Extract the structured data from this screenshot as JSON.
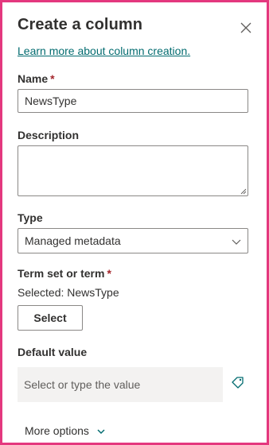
{
  "header": {
    "title": "Create a column",
    "learn_link": "Learn more about column creation."
  },
  "name_field": {
    "label": "Name",
    "required_mark": "*",
    "value": "NewsType"
  },
  "description_field": {
    "label": "Description",
    "value": ""
  },
  "type_field": {
    "label": "Type",
    "selected": "Managed metadata"
  },
  "term_set": {
    "label": "Term set or term",
    "required_mark": "*",
    "selected_text": "Selected: NewsType",
    "select_button": "Select"
  },
  "default_value": {
    "label": "Default value",
    "placeholder": "Select or type the value"
  },
  "more_options": {
    "label": "More options"
  },
  "colors": {
    "accent_link": "#036c70",
    "required": "#a4262c",
    "frame_border": "#e4387e"
  }
}
